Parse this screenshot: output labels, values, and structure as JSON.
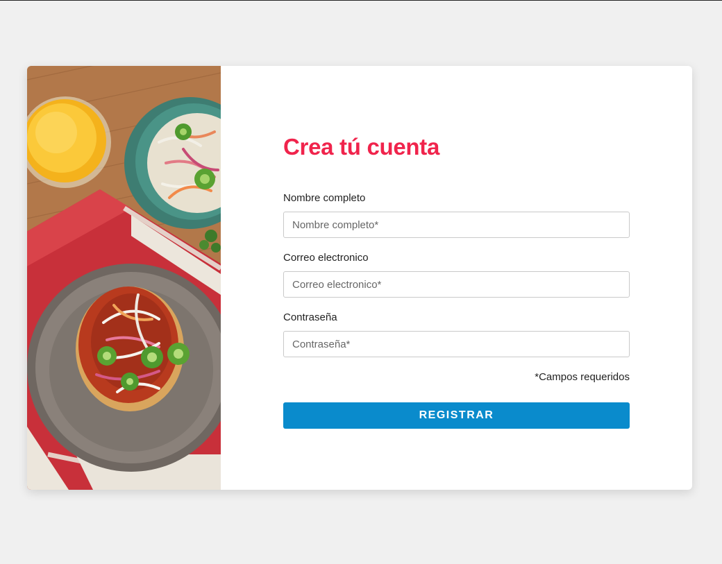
{
  "form": {
    "title": "Crea tú cuenta",
    "fields": [
      {
        "label": "Nombre completo",
        "placeholder": "Nombre completo*",
        "value": ""
      },
      {
        "label": "Correo electronico",
        "placeholder": "Correo electronico*",
        "value": ""
      },
      {
        "label": "Contraseña",
        "placeholder": "Contraseña*",
        "value": ""
      }
    ],
    "required_note": "*Campos requeridos",
    "submit_label": "REGISTRAR"
  },
  "colors": {
    "page_background": "#f0f0f0",
    "card_background": "#ffffff",
    "title": "#f0244c",
    "button": "#0a8bcc"
  }
}
